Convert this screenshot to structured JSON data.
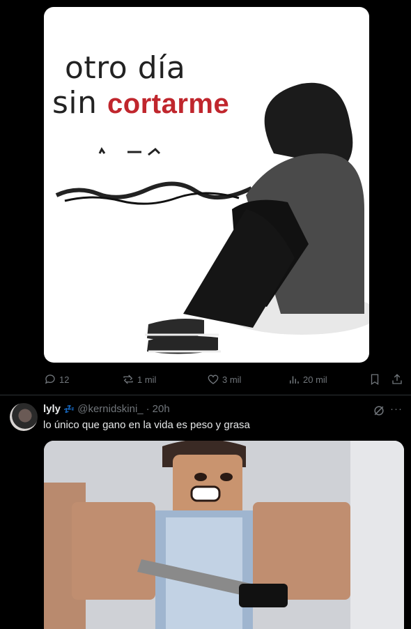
{
  "post1": {
    "meme_caption_line1": "otro día",
    "meme_caption_line2_prefix": "sin",
    "meme_caption_line2_highlight": "cortarme",
    "actions": {
      "replies": "12",
      "reposts": "1 mil",
      "likes": "3 mil",
      "views": "20 mil"
    }
  },
  "post2": {
    "display_name": "lyly",
    "name_emoji": "💤",
    "handle": "@kernidskini_",
    "separator": "·",
    "time": "20h",
    "text": "lo único que gano en la vida es peso y grasa",
    "more_label": "···"
  },
  "colors": {
    "background": "#000000",
    "text_primary": "#e7e9ea",
    "text_secondary": "#71767b",
    "accent": "#1d9bf0",
    "meme_red": "#c0262d"
  }
}
